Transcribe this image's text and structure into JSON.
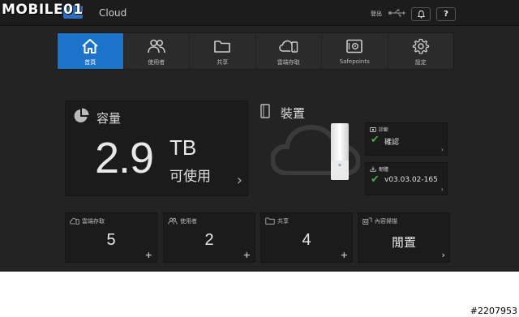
{
  "watermark": {
    "brand": "MOBILE01",
    "post_id": "#2207953"
  },
  "header": {
    "app_name": "Cloud",
    "logout_label": "登出",
    "help_label": "?"
  },
  "nav": {
    "tabs": [
      {
        "label": "首頁",
        "icon": "home-icon",
        "active": true
      },
      {
        "label": "使用者",
        "icon": "users-icon",
        "active": false
      },
      {
        "label": "共享",
        "icon": "folder-icon",
        "active": false
      },
      {
        "label": "雲端存取",
        "icon": "cloud-access-icon",
        "active": false
      },
      {
        "label": "Safepoints",
        "icon": "safe-icon",
        "active": false
      },
      {
        "label": "設定",
        "icon": "gear-icon",
        "active": false
      }
    ]
  },
  "capacity": {
    "title": "容量",
    "value": "2.9",
    "unit": "TB",
    "available_label": "可使用"
  },
  "device": {
    "title": "裝置",
    "diagnostics": {
      "title": "診斷",
      "status": "確認"
    },
    "firmware": {
      "title": "韌體",
      "version": "v03.03.02-165"
    }
  },
  "stats": {
    "cloud_access": {
      "title": "雲端存取",
      "value": "5",
      "action": "+"
    },
    "users": {
      "title": "使用者",
      "value": "2",
      "action": "+"
    },
    "shares": {
      "title": "共享",
      "value": "4",
      "action": "+"
    },
    "media": {
      "title": "內容掃描",
      "value": "閒置",
      "action": "›"
    }
  },
  "colors": {
    "accent": "#1b74c9",
    "background": "#232323",
    "panel": "#1b1b1b",
    "check": "#3fae3a"
  }
}
